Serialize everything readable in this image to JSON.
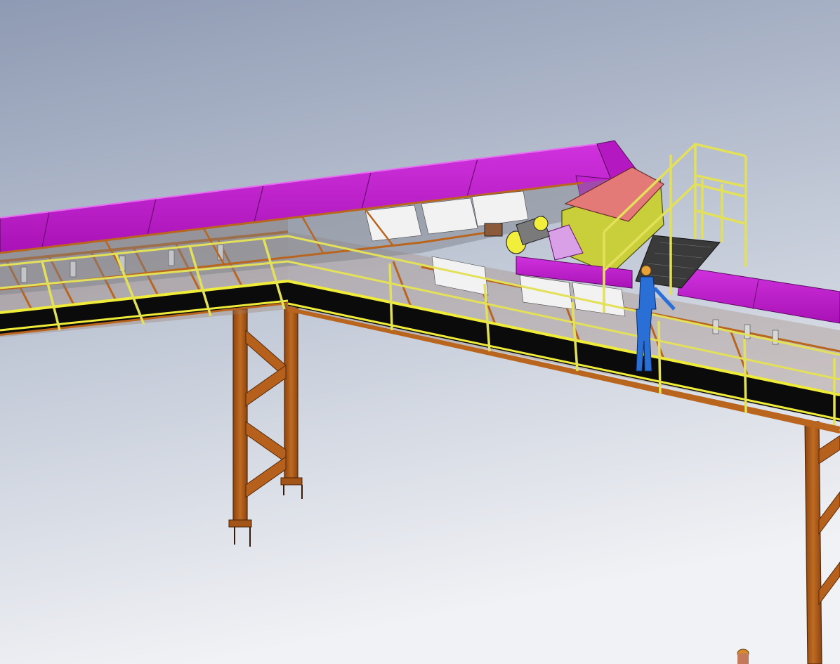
{
  "viewport": {
    "name": "cad-3d-viewport",
    "background_top": "#9aa6bd",
    "background_bottom": "#eef0f4"
  },
  "colors": {
    "steel": "#b9651e",
    "steel_dark": "#7a3a0e",
    "cover": "#c21fcf",
    "cover_light": "#e055ef",
    "rail": "#e3e05a",
    "belt": "#0b0b0b",
    "walkway_edge": "#f0ec3a",
    "hopper": "#c9cf3a",
    "hopper_cover": "#e47a78",
    "motor": "#f1ef3c",
    "worker_suit": "#2a6fd6",
    "worker_helmet": "#e8a23a",
    "grating": "#3a3a3a",
    "idler": "#cfcfcf"
  },
  "icons": {
    "conveyor": "inclined-belt-conveyor",
    "motor": "drive-motor-icon",
    "worker": "worker-figure"
  }
}
